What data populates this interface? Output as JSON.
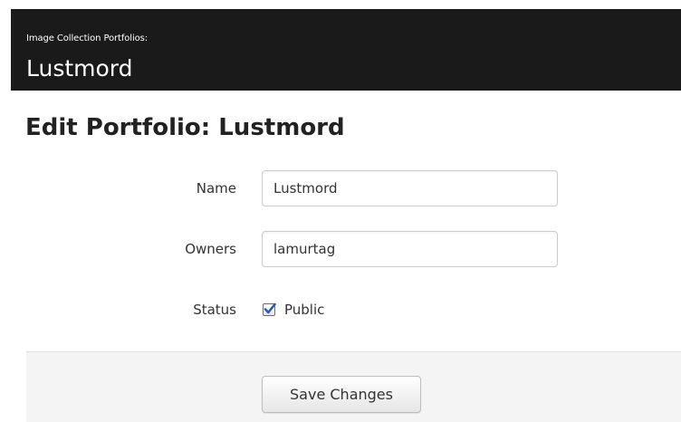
{
  "header": {
    "subtitle": "Image Collection Portfolios:",
    "title": "Lustmord",
    "background_color": "#1a1a1a"
  },
  "page": {
    "title": "Edit Portfolio: Lustmord"
  },
  "form": {
    "name": {
      "label": "Name",
      "value": "Lustmord"
    },
    "owners": {
      "label": "Owners",
      "value": "lamurtag"
    },
    "status": {
      "label": "Status",
      "checkbox_label": "Public",
      "checked": true,
      "check_color": "#2a5db0"
    }
  },
  "actions": {
    "save_label": "Save Changes"
  }
}
